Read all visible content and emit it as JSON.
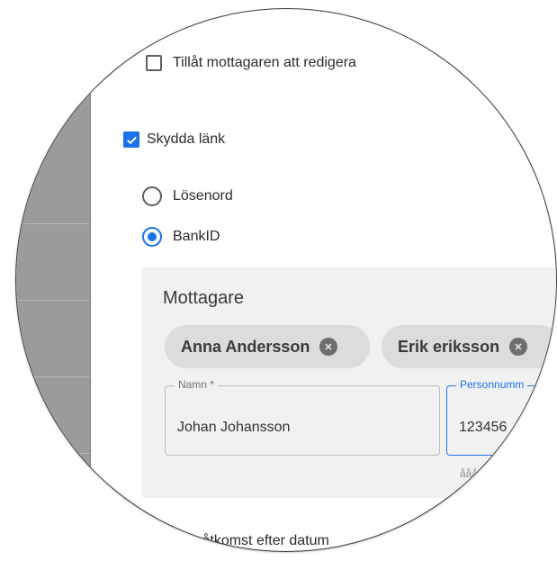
{
  "share_options": {
    "allow_edit": {
      "label": "Tillåt mottagaren att redigera",
      "checked": false
    },
    "protect_link": {
      "label": "Skydda länk",
      "checked": true
    }
  },
  "protection_methods": [
    {
      "label": "Lösenord",
      "selected": false
    },
    {
      "label": "BankID",
      "selected": true
    }
  ],
  "recipients": {
    "title": "Mottagare",
    "chips": [
      {
        "label": "Anna Andersson",
        "remove_icon": "clear-circle-icon"
      },
      {
        "label": "Erik eriksson",
        "remove_icon": "clear-circle-icon"
      }
    ],
    "fields": {
      "name": {
        "label": "Namn *",
        "value": "Johan Johansson"
      },
      "personal_number": {
        "label": "Personnumm",
        "value": "123456",
        "helper": "ååå"
      }
    }
  },
  "stop_access": {
    "label": "toppa åtkomst efter datum"
  },
  "colors": {
    "accent": "#1a73e8",
    "chip_bg": "#dcdcdc",
    "box_bg": "#f1f1f1",
    "backdrop": "#9b9b9b"
  }
}
